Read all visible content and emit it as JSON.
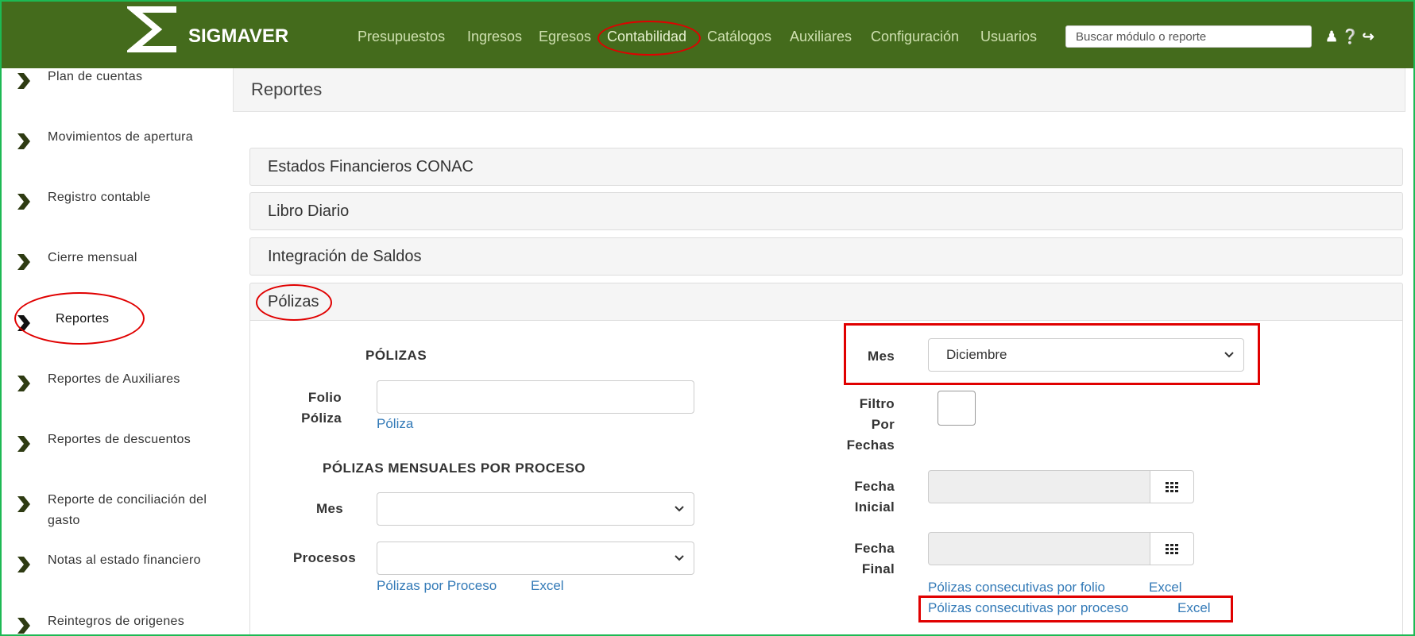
{
  "brand": {
    "name": "SIGMAVER",
    "logo_icon": "sigma-logo-icon"
  },
  "navbar": {
    "items": [
      "Presupuestos",
      "Ingresos",
      "Egresos",
      "Contabilidad",
      "Catálogos",
      "Auxiliares",
      "Configuración",
      "Usuarios"
    ],
    "active": "Contabilidad",
    "search_placeholder": "Buscar módulo o reporte",
    "icons": [
      "user-icon",
      "help-icon",
      "logout-icon"
    ]
  },
  "sidebar": {
    "items": [
      {
        "label": "Plan de cuentas"
      },
      {
        "label": "Movimientos de apertura"
      },
      {
        "label": "Registro contable"
      },
      {
        "label": "Cierre mensual"
      },
      {
        "label": "Reportes"
      },
      {
        "label": "Reportes de Auxiliares"
      },
      {
        "label": "Reportes de descuentos"
      },
      {
        "label": "Reporte de conciliación del gasto"
      },
      {
        "label": "Notas al estado financiero"
      },
      {
        "label": "Reintegros de origenes"
      }
    ],
    "active": "Reportes"
  },
  "page": {
    "title": "Reportes"
  },
  "accordion": {
    "sections": [
      {
        "title": "Estados Financieros CONAC"
      },
      {
        "title": "Libro Diario"
      },
      {
        "title": "Integración de Saldos"
      },
      {
        "title": "Pólizas"
      }
    ]
  },
  "polizas": {
    "header": "PÓLIZAS",
    "folio_label_1": "Folio",
    "folio_label_2": "Póliza",
    "folio_value": "",
    "poliza_link": "Póliza",
    "mensuales_header": "PÓLIZAS MENSUALES POR PROCESO",
    "mes_label": "Mes",
    "mes_value": "",
    "procesos_label": "Procesos",
    "procesos_value": "",
    "por_proceso_link": "Pólizas por Proceso",
    "excel_link": "Excel"
  },
  "right_panel": {
    "mes_label": "Mes",
    "mes_value": "Diciembre",
    "filtro_1": "Filtro",
    "filtro_2": "Por",
    "filtro_3": "Fechas",
    "filtro_checked": false,
    "fecha_inicial_1": "Fecha",
    "fecha_inicial_2": "Inicial",
    "fecha_final_1": "Fecha",
    "fecha_final_2": "Final",
    "calendar_icon": "calendar-grid-icon",
    "link_folio": "Pólizas consecutivas por folio",
    "link_folio_excel": "Excel",
    "link_proceso": "Pólizas consecutivas por proceso",
    "link_proceso_excel": "Excel"
  },
  "annotation_color": "#e00000",
  "brand_color": "#446b1c"
}
